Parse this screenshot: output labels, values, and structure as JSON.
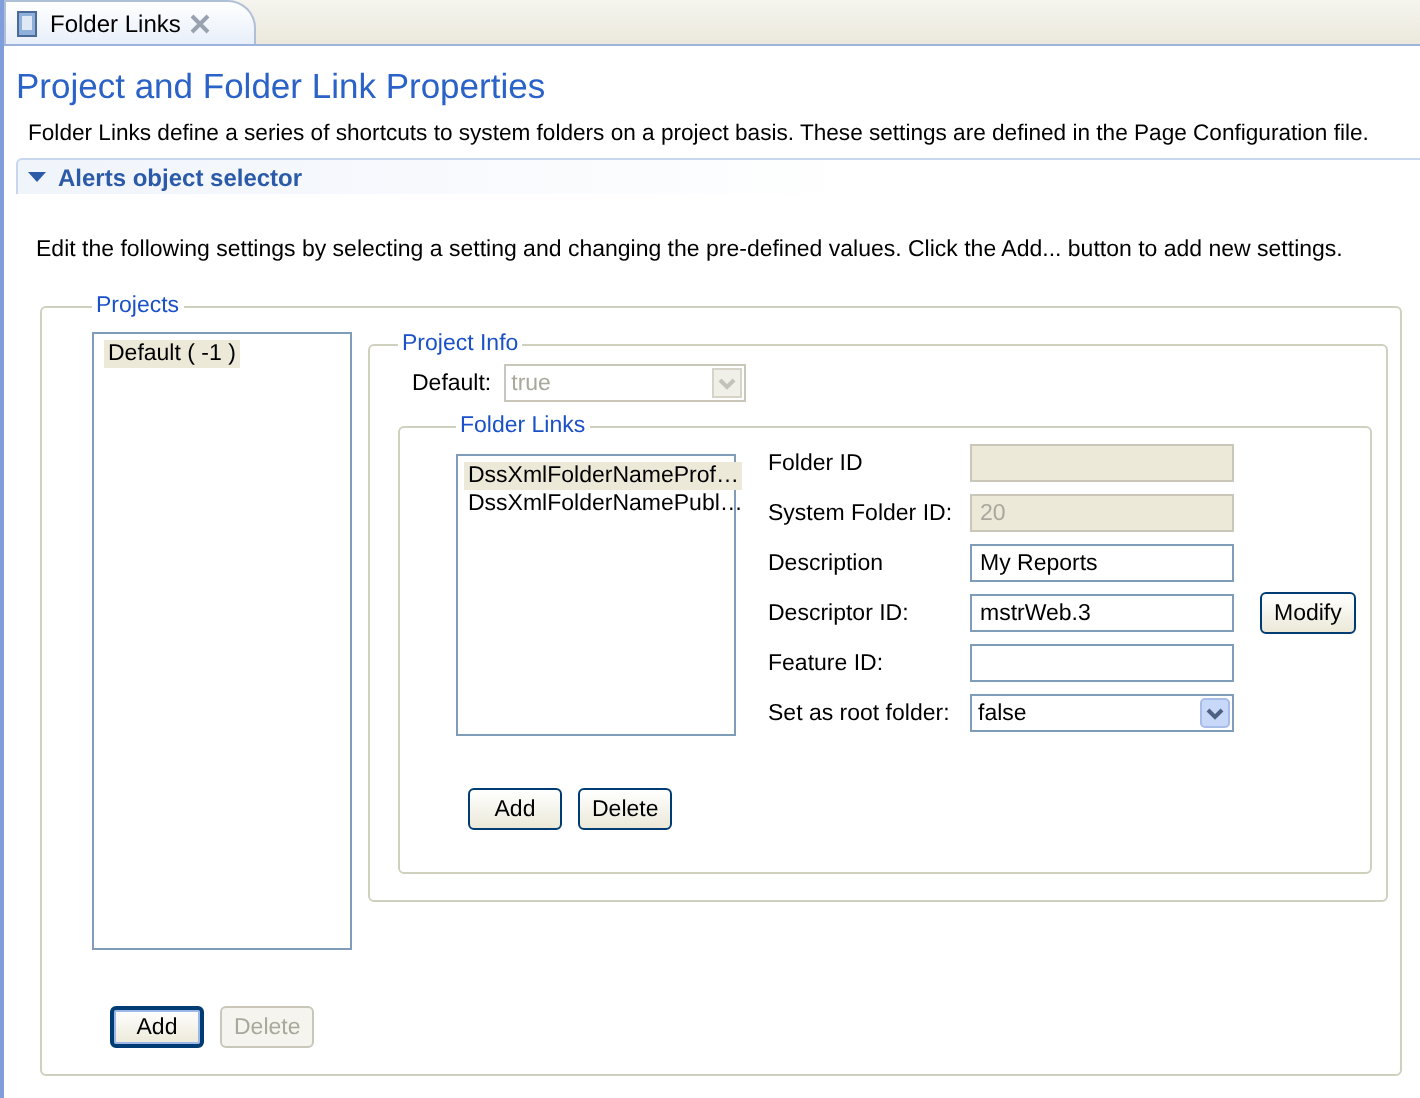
{
  "tab": {
    "title": "Folder Links",
    "selected": true
  },
  "title": "Project and Folder Link Properties",
  "description": "Folder Links define a series of shortcuts to system folders on a project basis. These settings are defined in the Page Configuration file.",
  "section": {
    "title": "Alerts object selector",
    "expanded": true
  },
  "instructions": "Edit the following settings by selecting a setting and changing the pre-defined values. Click the Add... button to add new settings.",
  "projects": {
    "legend": "Projects",
    "items": [
      {
        "label": "Default ( -1 )",
        "selected": true
      }
    ],
    "project_info": {
      "legend": "Project Info",
      "default_label": "Default:",
      "default_value": "true",
      "default_disabled": true,
      "folder_links": {
        "legend": "Folder Links",
        "items": [
          {
            "label": "DssXmlFolderNameProf…",
            "selected": true
          },
          {
            "label": "DssXmlFolderNamePubl…",
            "selected": false
          }
        ],
        "fields": [
          {
            "label": "Folder ID",
            "kind": "text",
            "disabled": true
          },
          {
            "label": "System Folder ID:",
            "kind": "text",
            "value": "20",
            "disabled": true
          },
          {
            "label": "Description",
            "kind": "text",
            "value": "My Reports",
            "disabled": false
          },
          {
            "label": "Descriptor ID:",
            "kind": "text",
            "value": "mstrWeb.3",
            "disabled": false,
            "button": "Modify"
          },
          {
            "label": "Feature ID:",
            "kind": "text",
            "disabled": false
          },
          {
            "label": "Set as root folder:",
            "kind": "select",
            "value": "false",
            "disabled": false
          }
        ],
        "buttons": [
          {
            "label": "Add",
            "disabled": false
          },
          {
            "label": "Delete",
            "disabled": false
          }
        ]
      }
    },
    "buttons": [
      {
        "label": "Add",
        "disabled": false,
        "default": true
      },
      {
        "label": "Delete",
        "disabled": true,
        "default": false
      }
    ]
  }
}
